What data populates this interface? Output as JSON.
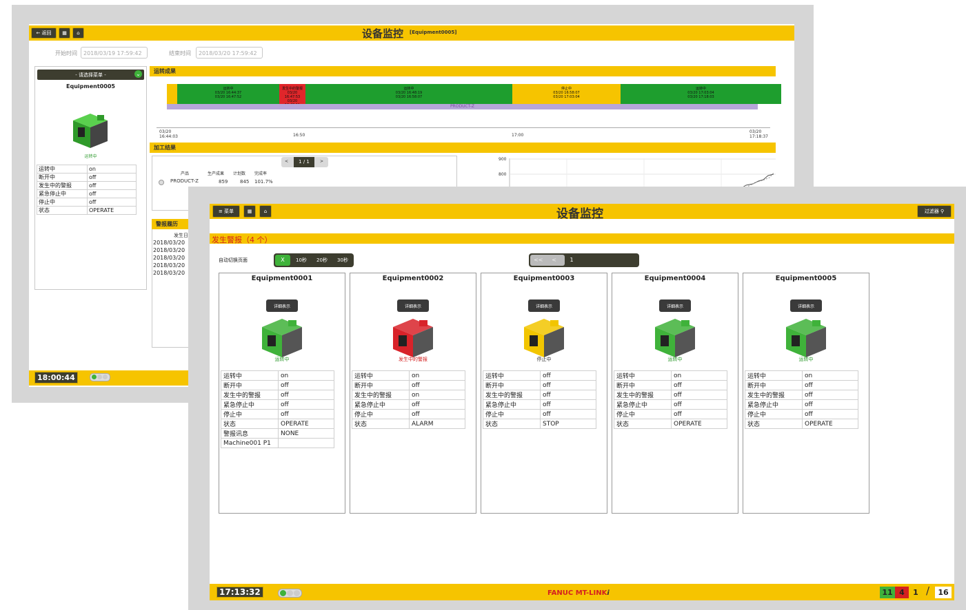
{
  "back": {
    "title": "设备监控",
    "subtitle": "[Equipment0005]",
    "nav": {
      "back_label": "返回"
    },
    "start_label": "开始时间",
    "start_value": "2018/03/19 17:59:42",
    "end_label": "结束时间",
    "end_value": "2018/03/20 17:59:42",
    "select_label": "- 请选择菜单 -",
    "equipment_name": "Equipment0005",
    "equipment_status": "运转中",
    "status_rows": [
      {
        "k": "运转中",
        "v": "on"
      },
      {
        "k": "断开中",
        "v": "off"
      },
      {
        "k": "发生中的警报",
        "v": "off"
      },
      {
        "k": "紧急停止中",
        "v": "off"
      },
      {
        "k": "停止中",
        "v": "off"
      },
      {
        "k": "状态",
        "v": "OPERATE"
      }
    ],
    "operation_result_label": "运转成果",
    "timeline_segments": [
      {
        "label": "运转中",
        "t1": "03/20 16:44:37",
        "t2": "03/20 16:47:52",
        "color": "#1e9e2e"
      },
      {
        "label": "发生中的警报",
        "t1": "03/20 16:47:53",
        "t2": "03/20 16:48:11",
        "color": "#e0262a"
      },
      {
        "label": "运转中",
        "t1": "03/20 16:48:19",
        "t2": "03/20 16:58:07",
        "color": "#1e9e2e"
      },
      {
        "label": "停止中",
        "t1": "03/20 16:58:07",
        "t2": "03/20 17:03:04",
        "color": "#f6c400"
      },
      {
        "label": "运转中",
        "t1": "03/20 17:03:04",
        "t2": "03/20 17:18:03",
        "color": "#1e9e2e"
      }
    ],
    "product_bar_label": "PRODUCT-Z",
    "axis_ticks": [
      "03/20\n16:44:03",
      "16:50",
      "17:00",
      "03/20\n17:18:37"
    ],
    "machining_result_label": "加工结果",
    "pager_label": "1 / 1",
    "product_table": {
      "headers": [
        "产品",
        "生产成果",
        "计划数",
        "完成率"
      ],
      "row": [
        "PRODUCT-Z",
        "859",
        "845",
        "101.7%"
      ]
    },
    "chart_ticks": [
      "900",
      "800"
    ],
    "alarm_history_label": "警报履历",
    "alarm_col": "发生日",
    "alarm_dates": [
      "2018/03/20",
      "2018/03/20",
      "2018/03/20",
      "2018/03/20",
      "2018/03/20"
    ],
    "clock": "18:00:44"
  },
  "front": {
    "title": "设备监控",
    "menu_label": "菜单",
    "filter_label": "过滤器",
    "alarm_banner": "发生警报（4 个）",
    "autoswitch_label": "自动切换页面",
    "autoswitch_options": [
      "X",
      "10秒",
      "20秒",
      "30秒"
    ],
    "pager": {
      "first": "<<",
      "prev": "<",
      "current": "1"
    },
    "detail_label": "详细表示",
    "cards": [
      {
        "name": "Equipment0001",
        "status": "运转中",
        "status_color": "#2e9a2e",
        "machine_color": "#3fb23a",
        "rows": [
          [
            "运转中",
            "on"
          ],
          [
            "断开中",
            "off"
          ],
          [
            "发生中的警报",
            "off"
          ],
          [
            "紧急停止中",
            "off"
          ],
          [
            "停止中",
            "off"
          ],
          [
            "状态",
            "OPERATE"
          ],
          [
            "警报讯息",
            "NONE"
          ],
          [
            "Machine001 P1",
            ""
          ]
        ]
      },
      {
        "name": "Equipment0002",
        "status": "发生中的警报",
        "status_color": "#d42020",
        "machine_color": "#d8232a",
        "rows": [
          [
            "运转中",
            "on"
          ],
          [
            "断开中",
            "off"
          ],
          [
            "发生中的警报",
            "on"
          ],
          [
            "紧急停止中",
            "off"
          ],
          [
            "停止中",
            "off"
          ],
          [
            "状态",
            "ALARM"
          ]
        ]
      },
      {
        "name": "Equipment0003",
        "status": "停止中",
        "status_color": "#333333",
        "machine_color": "#f2c500",
        "rows": [
          [
            "运转中",
            "off"
          ],
          [
            "断开中",
            "off"
          ],
          [
            "发生中的警报",
            "off"
          ],
          [
            "紧急停止中",
            "off"
          ],
          [
            "停止中",
            "off"
          ],
          [
            "状态",
            "STOP"
          ]
        ]
      },
      {
        "name": "Equipment0004",
        "status": "运转中",
        "status_color": "#2e9a2e",
        "machine_color": "#3fb23a",
        "rows": [
          [
            "运转中",
            "on"
          ],
          [
            "断开中",
            "off"
          ],
          [
            "发生中的警报",
            "off"
          ],
          [
            "紧急停止中",
            "off"
          ],
          [
            "停止中",
            "off"
          ],
          [
            "状态",
            "OPERATE"
          ]
        ]
      },
      {
        "name": "Equipment0005",
        "status": "运转中",
        "status_color": "#2e9a2e",
        "machine_color": "#3fb23a",
        "rows": [
          [
            "运转中",
            "on"
          ],
          [
            "断开中",
            "off"
          ],
          [
            "发生中的警报",
            "off"
          ],
          [
            "紧急停止中",
            "off"
          ],
          [
            "停止中",
            "off"
          ],
          [
            "状态",
            "OPERATE"
          ]
        ]
      }
    ],
    "clock": "17:13:32",
    "brand": "FANUC MT-LINK",
    "brand_suffix": "i",
    "counts": {
      "green": "11",
      "red": "4",
      "yellow": "1",
      "slash": "/",
      "total": "16"
    }
  }
}
